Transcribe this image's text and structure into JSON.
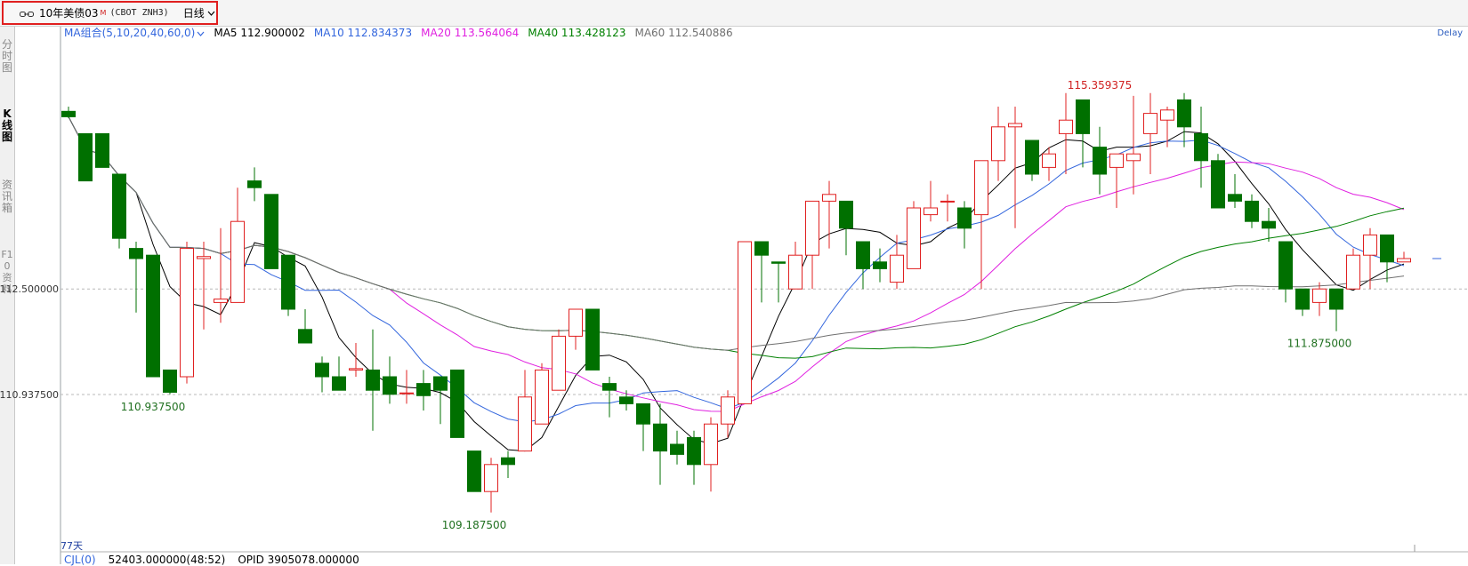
{
  "header": {
    "symbol_name": "10年美债03",
    "symbol_flag": "M",
    "symbol_code": "(CBOT ZNH3)",
    "period": "日线"
  },
  "left_tabs": [
    "分时图",
    "K线图",
    "资讯箱",
    "F10资料"
  ],
  "legend": {
    "combo": "MA组合(5,10,20,40,60,0)",
    "items": [
      {
        "label": "MA5 112.900002",
        "color": "#000000"
      },
      {
        "label": "MA10 112.834373",
        "color": "#3366dd"
      },
      {
        "label": "MA20 113.564064",
        "color": "#e020e0"
      },
      {
        "label": "MA40 113.428123",
        "color": "#008000"
      },
      {
        "label": "MA60 112.540886",
        "color": "#707070"
      }
    ]
  },
  "delay_text": "Delay",
  "days_label": "77天",
  "bottom": {
    "cjl": "CJL(0)",
    "volume": "52403.000000(48:52)",
    "opid": "OPID 3905078.000000"
  },
  "chart_data": {
    "type": "candlestick",
    "ylim": [
      108.95,
      116.2
    ],
    "y_ticks": [
      {
        "value": 112.5,
        "label": "112.500000"
      },
      {
        "value": 110.9375,
        "label": "110.937500"
      }
    ],
    "annotations": [
      {
        "label": "115.359375",
        "value": 115.359375,
        "index": 61,
        "color": "#d02020",
        "position": "above"
      },
      {
        "label": "110.937500",
        "value": 110.9375,
        "index": 5,
        "color": "#207020",
        "position": "below"
      },
      {
        "label": "109.187500",
        "value": 109.1875,
        "index": 24,
        "color": "#207020",
        "position": "below"
      },
      {
        "label": "111.875000",
        "value": 111.875,
        "index": 74,
        "color": "#207020",
        "position": "below"
      }
    ],
    "candles": [
      [
        115.13,
        115.05,
        115.2,
        115.03
      ],
      [
        114.8,
        114.1,
        114.8,
        114.1
      ],
      [
        114.8,
        114.3,
        114.8,
        114.3
      ],
      [
        114.2,
        113.25,
        114.2,
        113.1
      ],
      [
        113.1,
        112.95,
        113.2,
        112.15
      ],
      [
        113.0,
        111.2,
        113.0,
        111.2
      ],
      [
        111.3,
        110.97,
        111.3,
        110.94
      ],
      [
        111.2,
        113.1,
        113.2,
        111.1
      ],
      [
        112.95,
        112.98,
        113.2,
        111.9
      ],
      [
        112.3,
        112.35,
        113.4,
        112.0
      ],
      [
        112.3,
        113.5,
        114.0,
        112.3
      ],
      [
        114.1,
        114.0,
        114.3,
        113.8
      ],
      [
        113.9,
        112.8,
        113.9,
        112.8
      ],
      [
        113.0,
        112.2,
        113.0,
        112.1
      ],
      [
        111.9,
        111.7,
        112.2,
        111.7
      ],
      [
        111.4,
        111.2,
        111.5,
        110.97
      ],
      [
        111.2,
        111.0,
        111.5,
        111.0
      ],
      [
        111.3,
        111.32,
        111.7,
        111.2
      ],
      [
        111.3,
        111.0,
        111.9,
        110.4
      ],
      [
        111.2,
        110.94,
        111.5,
        110.8
      ],
      [
        110.95,
        110.96,
        111.3,
        110.8
      ],
      [
        111.1,
        110.92,
        111.3,
        110.7
      ],
      [
        111.2,
        111.0,
        111.2,
        110.5
      ],
      [
        111.3,
        110.3,
        111.3,
        110.3
      ],
      [
        110.1,
        109.5,
        110.1,
        109.5
      ],
      [
        109.5,
        109.9,
        110.0,
        109.19
      ],
      [
        110.0,
        109.9,
        110.1,
        109.7
      ],
      [
        110.1,
        110.9,
        111.3,
        110.1
      ],
      [
        110.5,
        111.3,
        111.4,
        110.5
      ],
      [
        111.0,
        111.8,
        111.9,
        111.0
      ],
      [
        111.8,
        112.2,
        112.2,
        111.6
      ],
      [
        112.2,
        111.3,
        112.2,
        111.3
      ],
      [
        111.1,
        111.0,
        111.2,
        110.6
      ],
      [
        110.9,
        110.8,
        111.0,
        110.7
      ],
      [
        110.8,
        110.5,
        110.8,
        110.1
      ],
      [
        110.5,
        110.1,
        110.8,
        109.6
      ],
      [
        110.2,
        110.05,
        110.4,
        109.9
      ],
      [
        110.3,
        109.9,
        110.4,
        109.6
      ],
      [
        109.9,
        110.5,
        110.6,
        109.5
      ],
      [
        110.5,
        110.9,
        111.0,
        110.3
      ],
      [
        110.8,
        113.2,
        113.2,
        110.8
      ],
      [
        113.2,
        113.0,
        113.2,
        112.3
      ],
      [
        112.9,
        112.88,
        112.9,
        112.3
      ],
      [
        112.5,
        113.0,
        113.2,
        112.5
      ],
      [
        113.0,
        113.8,
        113.8,
        112.5
      ],
      [
        113.8,
        113.9,
        114.1,
        113.1
      ],
      [
        113.8,
        113.4,
        113.8,
        113.0
      ],
      [
        113.2,
        112.8,
        113.2,
        112.5
      ],
      [
        112.9,
        112.8,
        113.1,
        112.6
      ],
      [
        112.6,
        113.0,
        113.3,
        112.5
      ],
      [
        112.8,
        113.7,
        113.8,
        112.8
      ],
      [
        113.6,
        113.7,
        114.1,
        113.5
      ],
      [
        113.8,
        113.8,
        113.9,
        113.5
      ],
      [
        113.7,
        113.4,
        113.8,
        113.1
      ],
      [
        113.6,
        114.4,
        114.4,
        112.5
      ],
      [
        114.4,
        114.9,
        115.2,
        114.1
      ],
      [
        114.9,
        114.95,
        115.2,
        113.4
      ],
      [
        114.7,
        114.2,
        114.7,
        114.1
      ],
      [
        114.3,
        114.5,
        114.6,
        114.1
      ],
      [
        114.8,
        115.0,
        115.4,
        114.2
      ],
      [
        115.3,
        114.8,
        115.3,
        114.3
      ],
      [
        114.6,
        114.2,
        114.9,
        113.9
      ],
      [
        114.3,
        114.5,
        114.5,
        113.7
      ],
      [
        114.4,
        114.5,
        115.36,
        113.9
      ],
      [
        114.8,
        115.1,
        115.4,
        114.2
      ],
      [
        115.0,
        115.15,
        115.2,
        114.6
      ],
      [
        115.3,
        114.9,
        115.4,
        114.6
      ],
      [
        114.8,
        114.4,
        115.2,
        114.0
      ],
      [
        114.4,
        113.7,
        114.5,
        113.7
      ],
      [
        113.9,
        113.8,
        114.2,
        113.7
      ],
      [
        113.8,
        113.5,
        113.9,
        113.4
      ],
      [
        113.5,
        113.4,
        113.7,
        113.2
      ],
      [
        113.2,
        112.5,
        113.2,
        112.3
      ],
      [
        112.5,
        112.2,
        112.5,
        112.1
      ],
      [
        112.3,
        112.5,
        112.6,
        112.1
      ],
      [
        112.5,
        112.2,
        112.5,
        111.875
      ],
      [
        112.5,
        113.0,
        113.1,
        112.5
      ],
      [
        113.0,
        113.3,
        113.4,
        112.5
      ],
      [
        113.3,
        112.9,
        113.3,
        112.6
      ],
      [
        112.9,
        112.95,
        113.05,
        112.9
      ]
    ]
  }
}
